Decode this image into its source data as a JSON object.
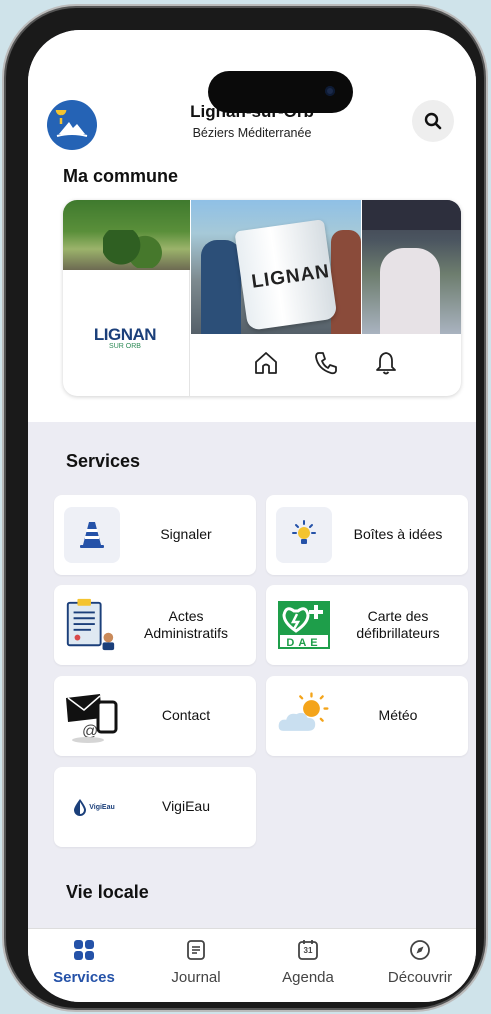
{
  "header": {
    "town": "Lignan-sur-Orb",
    "region": "Béziers Méditerranée"
  },
  "commune": {
    "title": "Ma commune",
    "logo_main": "LIGNAN",
    "logo_sub": "SUR ORB",
    "mug_text": "LIGNAN",
    "actions": [
      "home-icon",
      "phone-icon",
      "bell-icon"
    ]
  },
  "services": {
    "title": "Services",
    "items": [
      {
        "label": "Signaler",
        "icon": "traffic-cone-icon"
      },
      {
        "label": "Boîtes à idées",
        "icon": "lightbulb-icon"
      },
      {
        "label": "Actes\nAdministratifs",
        "icon": "document-icon"
      },
      {
        "label": "Carte des\ndéfibrillateurs",
        "icon": "defibrillator-icon"
      },
      {
        "label": "Contact",
        "icon": "contact-icon"
      },
      {
        "label": "Météo",
        "icon": "weather-icon"
      },
      {
        "label": "VigiEau",
        "icon": "vigieau-logo-icon"
      }
    ],
    "dae_text": "DAE",
    "vigieau_logo_text": "VigiEau"
  },
  "vie_locale": {
    "title": "Vie locale"
  },
  "tabbar": {
    "tabs": [
      {
        "label": "Services",
        "icon": "grid-icon",
        "active": true
      },
      {
        "label": "Journal",
        "icon": "newspaper-icon",
        "active": false
      },
      {
        "label": "Agenda",
        "icon": "calendar-icon",
        "active": false,
        "icon_text": "31"
      },
      {
        "label": "Découvrir",
        "icon": "compass-icon",
        "active": false
      }
    ]
  },
  "colors": {
    "accent": "#2552a8",
    "background": "#ececf3",
    "dae_green": "#1e9e4a"
  }
}
